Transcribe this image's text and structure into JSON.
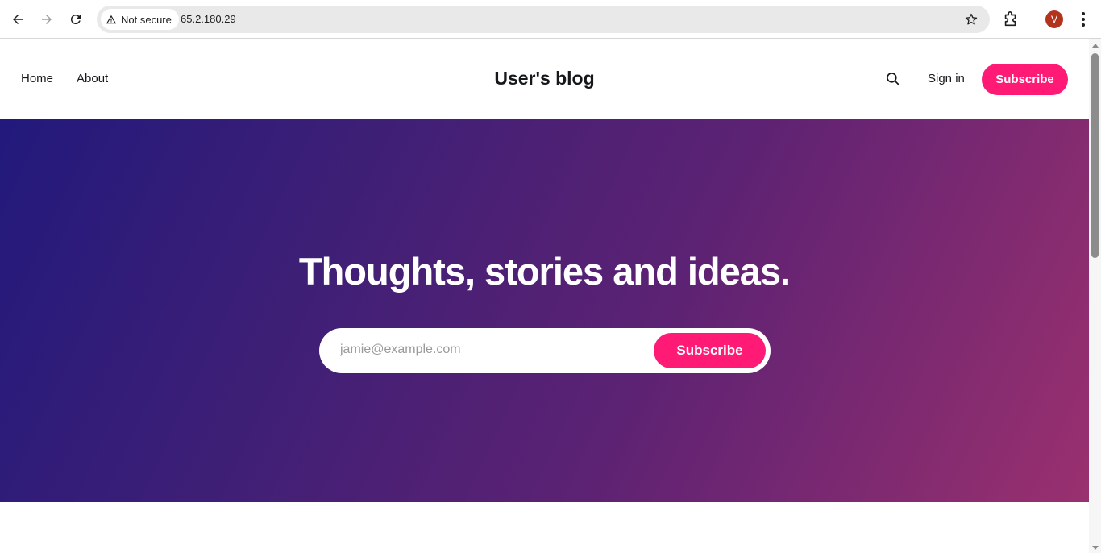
{
  "browser": {
    "security_label": "Not secure",
    "url": "65.2.180.29",
    "avatar_letter": "V"
  },
  "site": {
    "nav": [
      "Home",
      "About"
    ],
    "title": "User's blog",
    "signin_label": "Sign in",
    "subscribe_label": "Subscribe",
    "accent_color": "#ff1a75"
  },
  "hero": {
    "heading": "Thoughts, stories and ideas.",
    "email_placeholder": "jamie@example.com",
    "subscribe_label": "Subscribe"
  }
}
